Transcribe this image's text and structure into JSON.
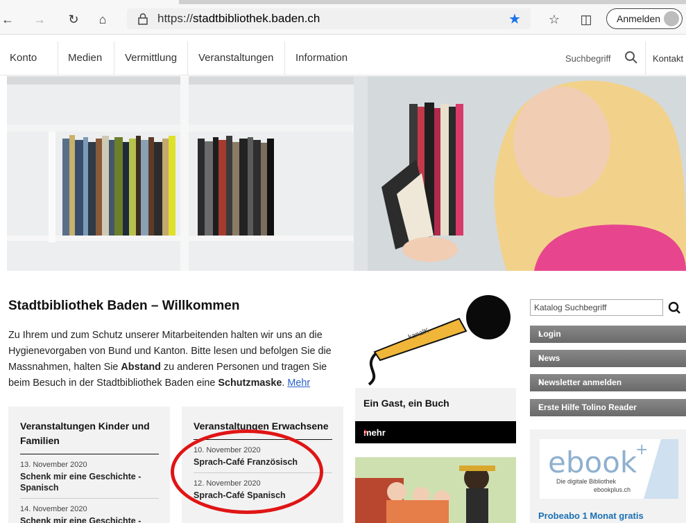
{
  "browser": {
    "url_prefix": "https://",
    "url_domain": "stadtbibliothek.baden.ch",
    "signin_label": "Anmelden"
  },
  "nav": {
    "items": [
      "Konto",
      "Medien",
      "Vermittlung",
      "Veranstaltungen",
      "Information"
    ],
    "search_label": "Suchbegriff",
    "contact": "Kontakt"
  },
  "welcome": {
    "title": "Stadtbibliothek Baden – Willkommen",
    "text_1": "Zu Ihrem und zum Schutz unserer Mitarbeitenden halten wir uns an die Hygienevorgaben von Bund und Kanton. Bitte lesen und befolgen Sie die Massnahmen, halten Sie ",
    "bold_1": "Abstand",
    "text_2": " zu anderen Personen und tragen Sie beim Besuch in der Stadtbibliothek Baden eine ",
    "bold_2": "Schutzmaske",
    "text_3": ". ",
    "more_link": "Mehr"
  },
  "cards": [
    {
      "heading": "Veranstaltungen Kinder und Familien",
      "events": [
        {
          "date": "13. November 2020",
          "title": "Schenk mir eine Geschichte - Spanisch"
        },
        {
          "date": "14. November 2020",
          "title": "Schenk mir eine Geschichte -"
        }
      ]
    },
    {
      "heading": "Veranstaltungen Erwachsene",
      "events": [
        {
          "date": "10. November 2020",
          "title": "Sprach-Café Französisch"
        },
        {
          "date": "12. November 2020",
          "title": "Sprach-Café Spanisch"
        }
      ]
    }
  ],
  "middle": {
    "mic_brand": "kanalK",
    "guest_title": "Ein Gast, ein Buch",
    "mehr_label": "mehr"
  },
  "sidebar": {
    "search_placeholder": "Katalog Suchbegriff",
    "buttons": [
      "Login",
      "News",
      "Newsletter anmelden",
      "Erste Hilfe Tolino Reader"
    ],
    "ebook_logo": "ebook",
    "ebook_plus": "+",
    "ebook_sub1": "Die digitale Bibliothek",
    "ebook_sub2": "ebookplus.ch",
    "promo": "Probeabo 1 Monat gratis"
  }
}
